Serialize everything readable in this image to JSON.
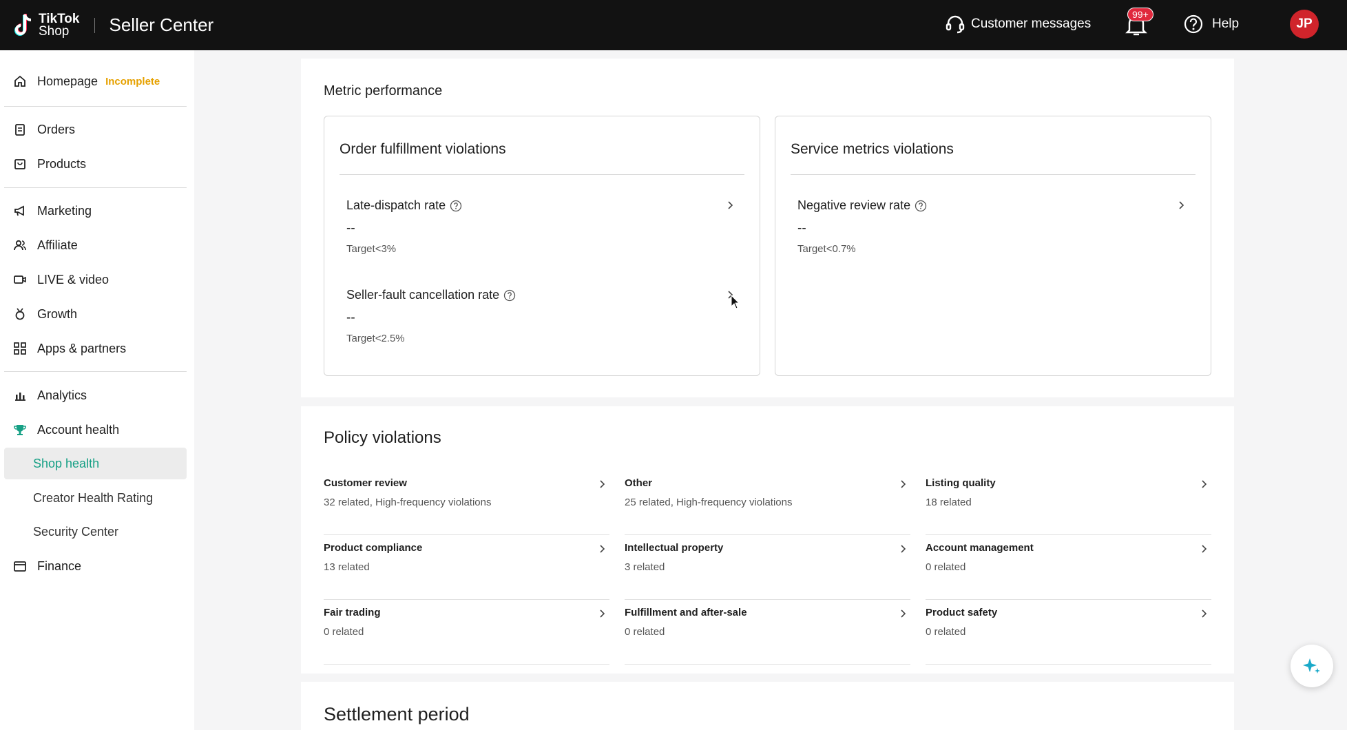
{
  "header": {
    "logo_line1": "TikTok",
    "logo_line2": "Shop",
    "app_title": "Seller Center",
    "customer_messages": "Customer messages",
    "notification_badge": "99+",
    "help": "Help",
    "avatar_initials": "JP"
  },
  "sidebar": {
    "homepage": "Homepage",
    "homepage_status": "Incomplete",
    "items": [
      {
        "label": "Orders",
        "icon": "clipboard-icon"
      },
      {
        "label": "Products",
        "icon": "bag-icon"
      },
      {
        "label": "Marketing",
        "icon": "megaphone-icon"
      },
      {
        "label": "Affiliate",
        "icon": "people-icon"
      },
      {
        "label": "LIVE & video",
        "icon": "video-icon"
      },
      {
        "label": "Growth",
        "icon": "medal-icon"
      },
      {
        "label": "Apps & partners",
        "icon": "apps-icon"
      },
      {
        "label": "Analytics",
        "icon": "chart-icon"
      },
      {
        "label": "Account health",
        "icon": "trophy-icon"
      },
      {
        "label": "Shop health",
        "icon": ""
      },
      {
        "label": "Creator Health Rating",
        "icon": ""
      },
      {
        "label": "Security Center",
        "icon": ""
      },
      {
        "label": "Finance",
        "icon": "wallet-icon"
      }
    ]
  },
  "metric_performance": {
    "title": "Metric performance",
    "order_fulfillment": {
      "title": "Order fulfillment violations",
      "metrics": [
        {
          "name": "Late-dispatch rate",
          "value": "--",
          "target": "Target<3%"
        },
        {
          "name": "Seller-fault cancellation rate",
          "value": "--",
          "target": "Target<2.5%"
        }
      ]
    },
    "service_metrics": {
      "title": "Service metrics violations",
      "metrics": [
        {
          "name": "Negative review rate",
          "value": "--",
          "target": "Target<0.7%"
        }
      ]
    }
  },
  "policy_violations": {
    "title": "Policy violations",
    "items": [
      {
        "name": "Customer review",
        "count": "32",
        "suffix": " related, High-frequency violations"
      },
      {
        "name": "Other",
        "count": "25",
        "suffix": " related, High-frequency violations"
      },
      {
        "name": "Listing quality",
        "count": "18",
        "suffix": " related"
      },
      {
        "name": "Product compliance",
        "count": "13",
        "suffix": " related"
      },
      {
        "name": "Intellectual property",
        "count": "3",
        "suffix": " related"
      },
      {
        "name": "Account management",
        "count": "0",
        "suffix": " related"
      },
      {
        "name": "Fair trading",
        "count": "0",
        "suffix": " related"
      },
      {
        "name": "Fulfillment and after-sale",
        "count": "0",
        "suffix": " related"
      },
      {
        "name": "Product safety",
        "count": "0",
        "suffix": " related"
      }
    ]
  },
  "settlement": {
    "title": "Settlement period"
  },
  "colors": {
    "topbar": "#121212",
    "accent": "#16a085",
    "incomplete": "#e6a100",
    "badge": "#e0283c",
    "avatar": "#d0242b"
  }
}
